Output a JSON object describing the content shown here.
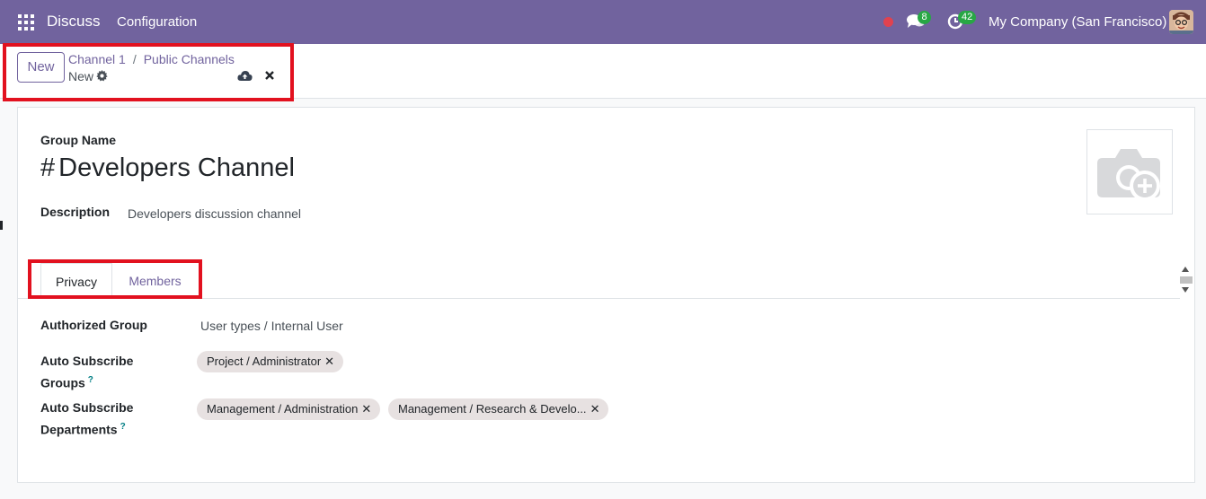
{
  "navbar": {
    "app_name": "Discuss",
    "menu_configuration": "Configuration",
    "messages_count": "8",
    "activities_count": "42",
    "company": "My Company (San Francisco)",
    "accent_color": "#71639e"
  },
  "control_panel": {
    "new_button": "New",
    "breadcrumb": [
      "Channel 1",
      "Public Channels"
    ],
    "breadcrumb_separator": "/",
    "record_name": "New",
    "icons": [
      "gear-icon",
      "save-cloud-icon",
      "discard-icon"
    ]
  },
  "form": {
    "group_name_label": "Group Name",
    "hash": "#",
    "channel_name": "Developers Channel",
    "description_label": "Description",
    "description_value": "Developers discussion channel",
    "image_placeholder_icon": "camera-plus-icon"
  },
  "tabs": [
    {
      "label": "Privacy",
      "active": true
    },
    {
      "label": "Members",
      "active": false
    }
  ],
  "privacy": {
    "authorized_group_label": "Authorized Group",
    "authorized_group_value": "User types / Internal User",
    "auto_subscribe_groups_label": "Auto Subscribe Groups",
    "auto_subscribe_groups_tags": [
      "Project / Administrator"
    ],
    "auto_subscribe_departments_label": "Auto Subscribe Departments",
    "auto_subscribe_departments_tags": [
      "Management / Administration",
      "Management / Research & Develo..."
    ],
    "help_mark": "?",
    "remove_mark": "✕"
  },
  "highlight_color": "#e2111f"
}
